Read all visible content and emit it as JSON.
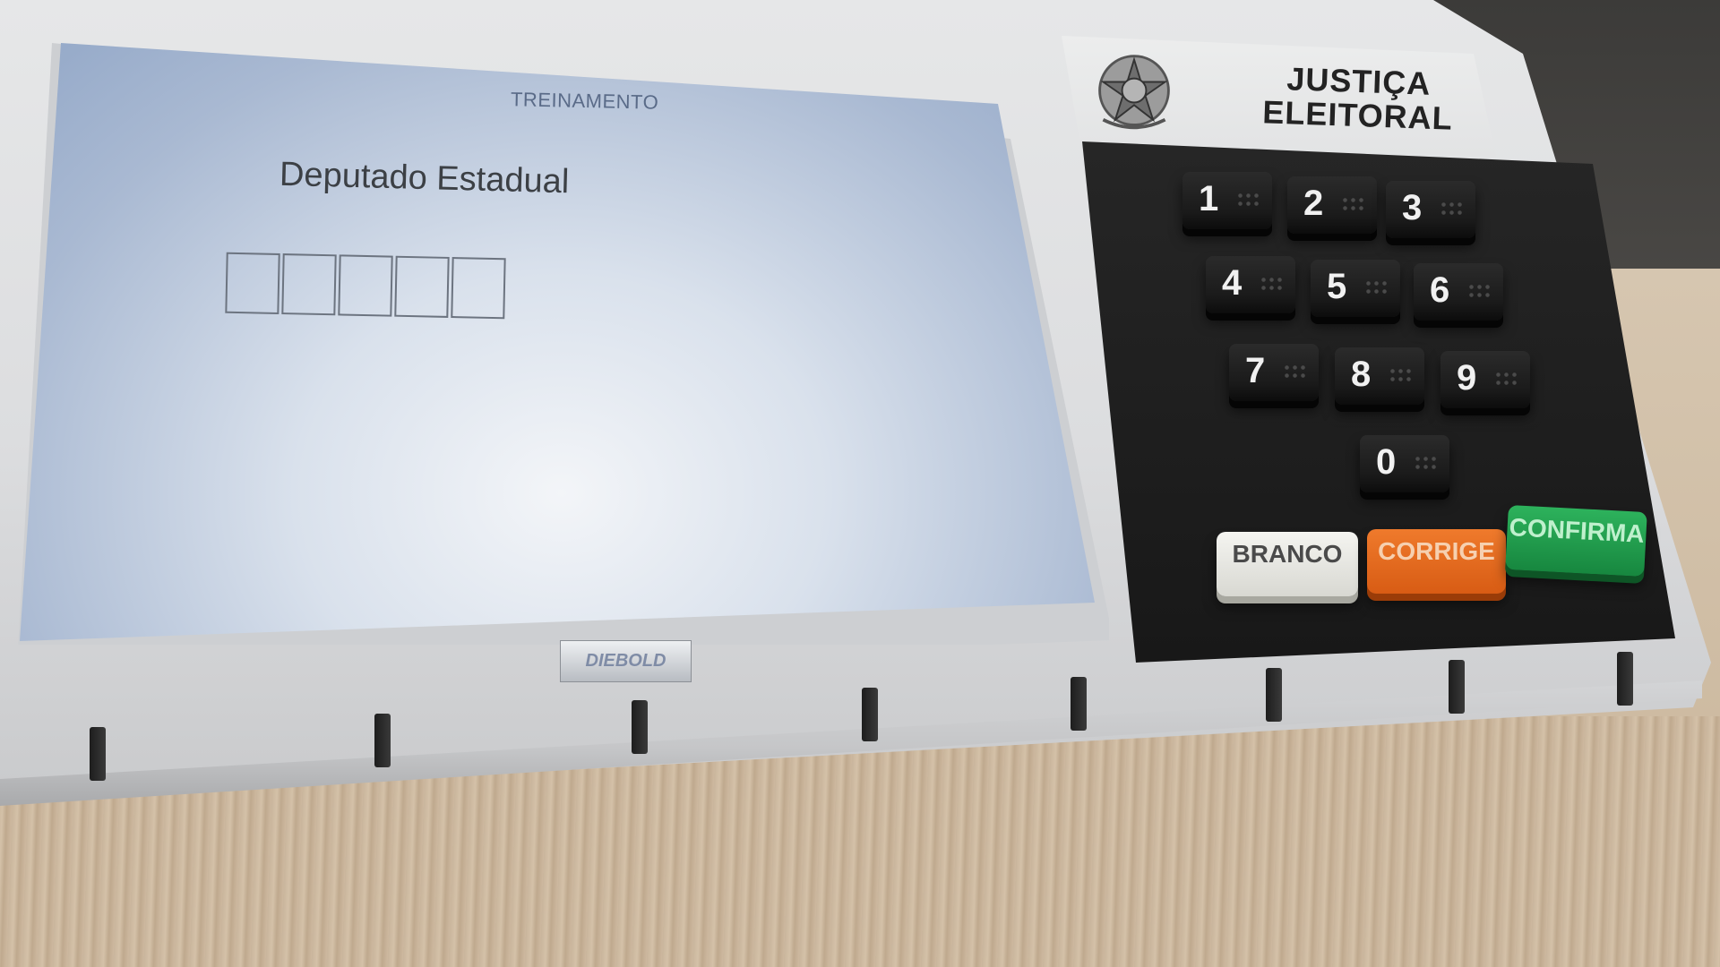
{
  "screen": {
    "header": "TREINAMENTO",
    "office_title": "Deputado Estadual",
    "digit_slots": [
      "",
      "",
      "",
      "",
      ""
    ]
  },
  "device": {
    "brand": "DIEBOLD",
    "authority_line1": "JUSTIÇA",
    "authority_line2": "ELEITORAL",
    "emblem_icon": "brazil-coat-of-arms-icon"
  },
  "keypad": {
    "digits": [
      "1",
      "2",
      "3",
      "4",
      "5",
      "6",
      "7",
      "8",
      "9",
      "0"
    ],
    "branco_label": "BRANCO",
    "corrige_label": "CORRIGE",
    "confirma_label": "CONFIRMA"
  },
  "colors": {
    "screen": "#a9b9d2",
    "keypad": "#1e1e1e",
    "branco": "#f1f1ec",
    "corrige": "#e56b1f",
    "confirma": "#22a24f"
  }
}
